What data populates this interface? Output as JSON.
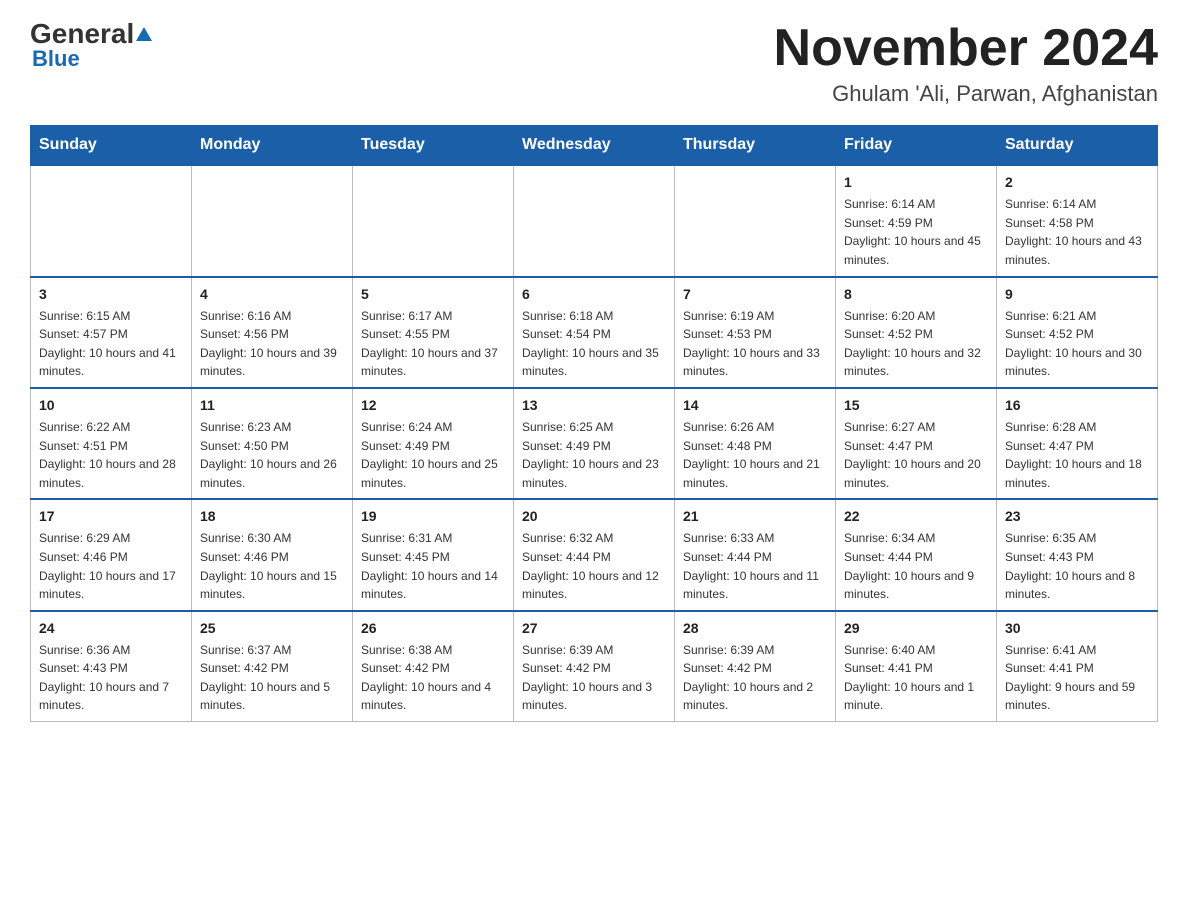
{
  "logo": {
    "general": "General",
    "blue": "Blue"
  },
  "title": {
    "month_year": "November 2024",
    "location": "Ghulam 'Ali, Parwan, Afghanistan"
  },
  "days_of_week": [
    "Sunday",
    "Monday",
    "Tuesday",
    "Wednesday",
    "Thursday",
    "Friday",
    "Saturday"
  ],
  "weeks": [
    {
      "cells": [
        {
          "day": "",
          "info": ""
        },
        {
          "day": "",
          "info": ""
        },
        {
          "day": "",
          "info": ""
        },
        {
          "day": "",
          "info": ""
        },
        {
          "day": "",
          "info": ""
        },
        {
          "day": "1",
          "info": "Sunrise: 6:14 AM\nSunset: 4:59 PM\nDaylight: 10 hours and 45 minutes."
        },
        {
          "day": "2",
          "info": "Sunrise: 6:14 AM\nSunset: 4:58 PM\nDaylight: 10 hours and 43 minutes."
        }
      ]
    },
    {
      "cells": [
        {
          "day": "3",
          "info": "Sunrise: 6:15 AM\nSunset: 4:57 PM\nDaylight: 10 hours and 41 minutes."
        },
        {
          "day": "4",
          "info": "Sunrise: 6:16 AM\nSunset: 4:56 PM\nDaylight: 10 hours and 39 minutes."
        },
        {
          "day": "5",
          "info": "Sunrise: 6:17 AM\nSunset: 4:55 PM\nDaylight: 10 hours and 37 minutes."
        },
        {
          "day": "6",
          "info": "Sunrise: 6:18 AM\nSunset: 4:54 PM\nDaylight: 10 hours and 35 minutes."
        },
        {
          "day": "7",
          "info": "Sunrise: 6:19 AM\nSunset: 4:53 PM\nDaylight: 10 hours and 33 minutes."
        },
        {
          "day": "8",
          "info": "Sunrise: 6:20 AM\nSunset: 4:52 PM\nDaylight: 10 hours and 32 minutes."
        },
        {
          "day": "9",
          "info": "Sunrise: 6:21 AM\nSunset: 4:52 PM\nDaylight: 10 hours and 30 minutes."
        }
      ]
    },
    {
      "cells": [
        {
          "day": "10",
          "info": "Sunrise: 6:22 AM\nSunset: 4:51 PM\nDaylight: 10 hours and 28 minutes."
        },
        {
          "day": "11",
          "info": "Sunrise: 6:23 AM\nSunset: 4:50 PM\nDaylight: 10 hours and 26 minutes."
        },
        {
          "day": "12",
          "info": "Sunrise: 6:24 AM\nSunset: 4:49 PM\nDaylight: 10 hours and 25 minutes."
        },
        {
          "day": "13",
          "info": "Sunrise: 6:25 AM\nSunset: 4:49 PM\nDaylight: 10 hours and 23 minutes."
        },
        {
          "day": "14",
          "info": "Sunrise: 6:26 AM\nSunset: 4:48 PM\nDaylight: 10 hours and 21 minutes."
        },
        {
          "day": "15",
          "info": "Sunrise: 6:27 AM\nSunset: 4:47 PM\nDaylight: 10 hours and 20 minutes."
        },
        {
          "day": "16",
          "info": "Sunrise: 6:28 AM\nSunset: 4:47 PM\nDaylight: 10 hours and 18 minutes."
        }
      ]
    },
    {
      "cells": [
        {
          "day": "17",
          "info": "Sunrise: 6:29 AM\nSunset: 4:46 PM\nDaylight: 10 hours and 17 minutes."
        },
        {
          "day": "18",
          "info": "Sunrise: 6:30 AM\nSunset: 4:46 PM\nDaylight: 10 hours and 15 minutes."
        },
        {
          "day": "19",
          "info": "Sunrise: 6:31 AM\nSunset: 4:45 PM\nDaylight: 10 hours and 14 minutes."
        },
        {
          "day": "20",
          "info": "Sunrise: 6:32 AM\nSunset: 4:44 PM\nDaylight: 10 hours and 12 minutes."
        },
        {
          "day": "21",
          "info": "Sunrise: 6:33 AM\nSunset: 4:44 PM\nDaylight: 10 hours and 11 minutes."
        },
        {
          "day": "22",
          "info": "Sunrise: 6:34 AM\nSunset: 4:44 PM\nDaylight: 10 hours and 9 minutes."
        },
        {
          "day": "23",
          "info": "Sunrise: 6:35 AM\nSunset: 4:43 PM\nDaylight: 10 hours and 8 minutes."
        }
      ]
    },
    {
      "cells": [
        {
          "day": "24",
          "info": "Sunrise: 6:36 AM\nSunset: 4:43 PM\nDaylight: 10 hours and 7 minutes."
        },
        {
          "day": "25",
          "info": "Sunrise: 6:37 AM\nSunset: 4:42 PM\nDaylight: 10 hours and 5 minutes."
        },
        {
          "day": "26",
          "info": "Sunrise: 6:38 AM\nSunset: 4:42 PM\nDaylight: 10 hours and 4 minutes."
        },
        {
          "day": "27",
          "info": "Sunrise: 6:39 AM\nSunset: 4:42 PM\nDaylight: 10 hours and 3 minutes."
        },
        {
          "day": "28",
          "info": "Sunrise: 6:39 AM\nSunset: 4:42 PM\nDaylight: 10 hours and 2 minutes."
        },
        {
          "day": "29",
          "info": "Sunrise: 6:40 AM\nSunset: 4:41 PM\nDaylight: 10 hours and 1 minute."
        },
        {
          "day": "30",
          "info": "Sunrise: 6:41 AM\nSunset: 4:41 PM\nDaylight: 9 hours and 59 minutes."
        }
      ]
    }
  ]
}
